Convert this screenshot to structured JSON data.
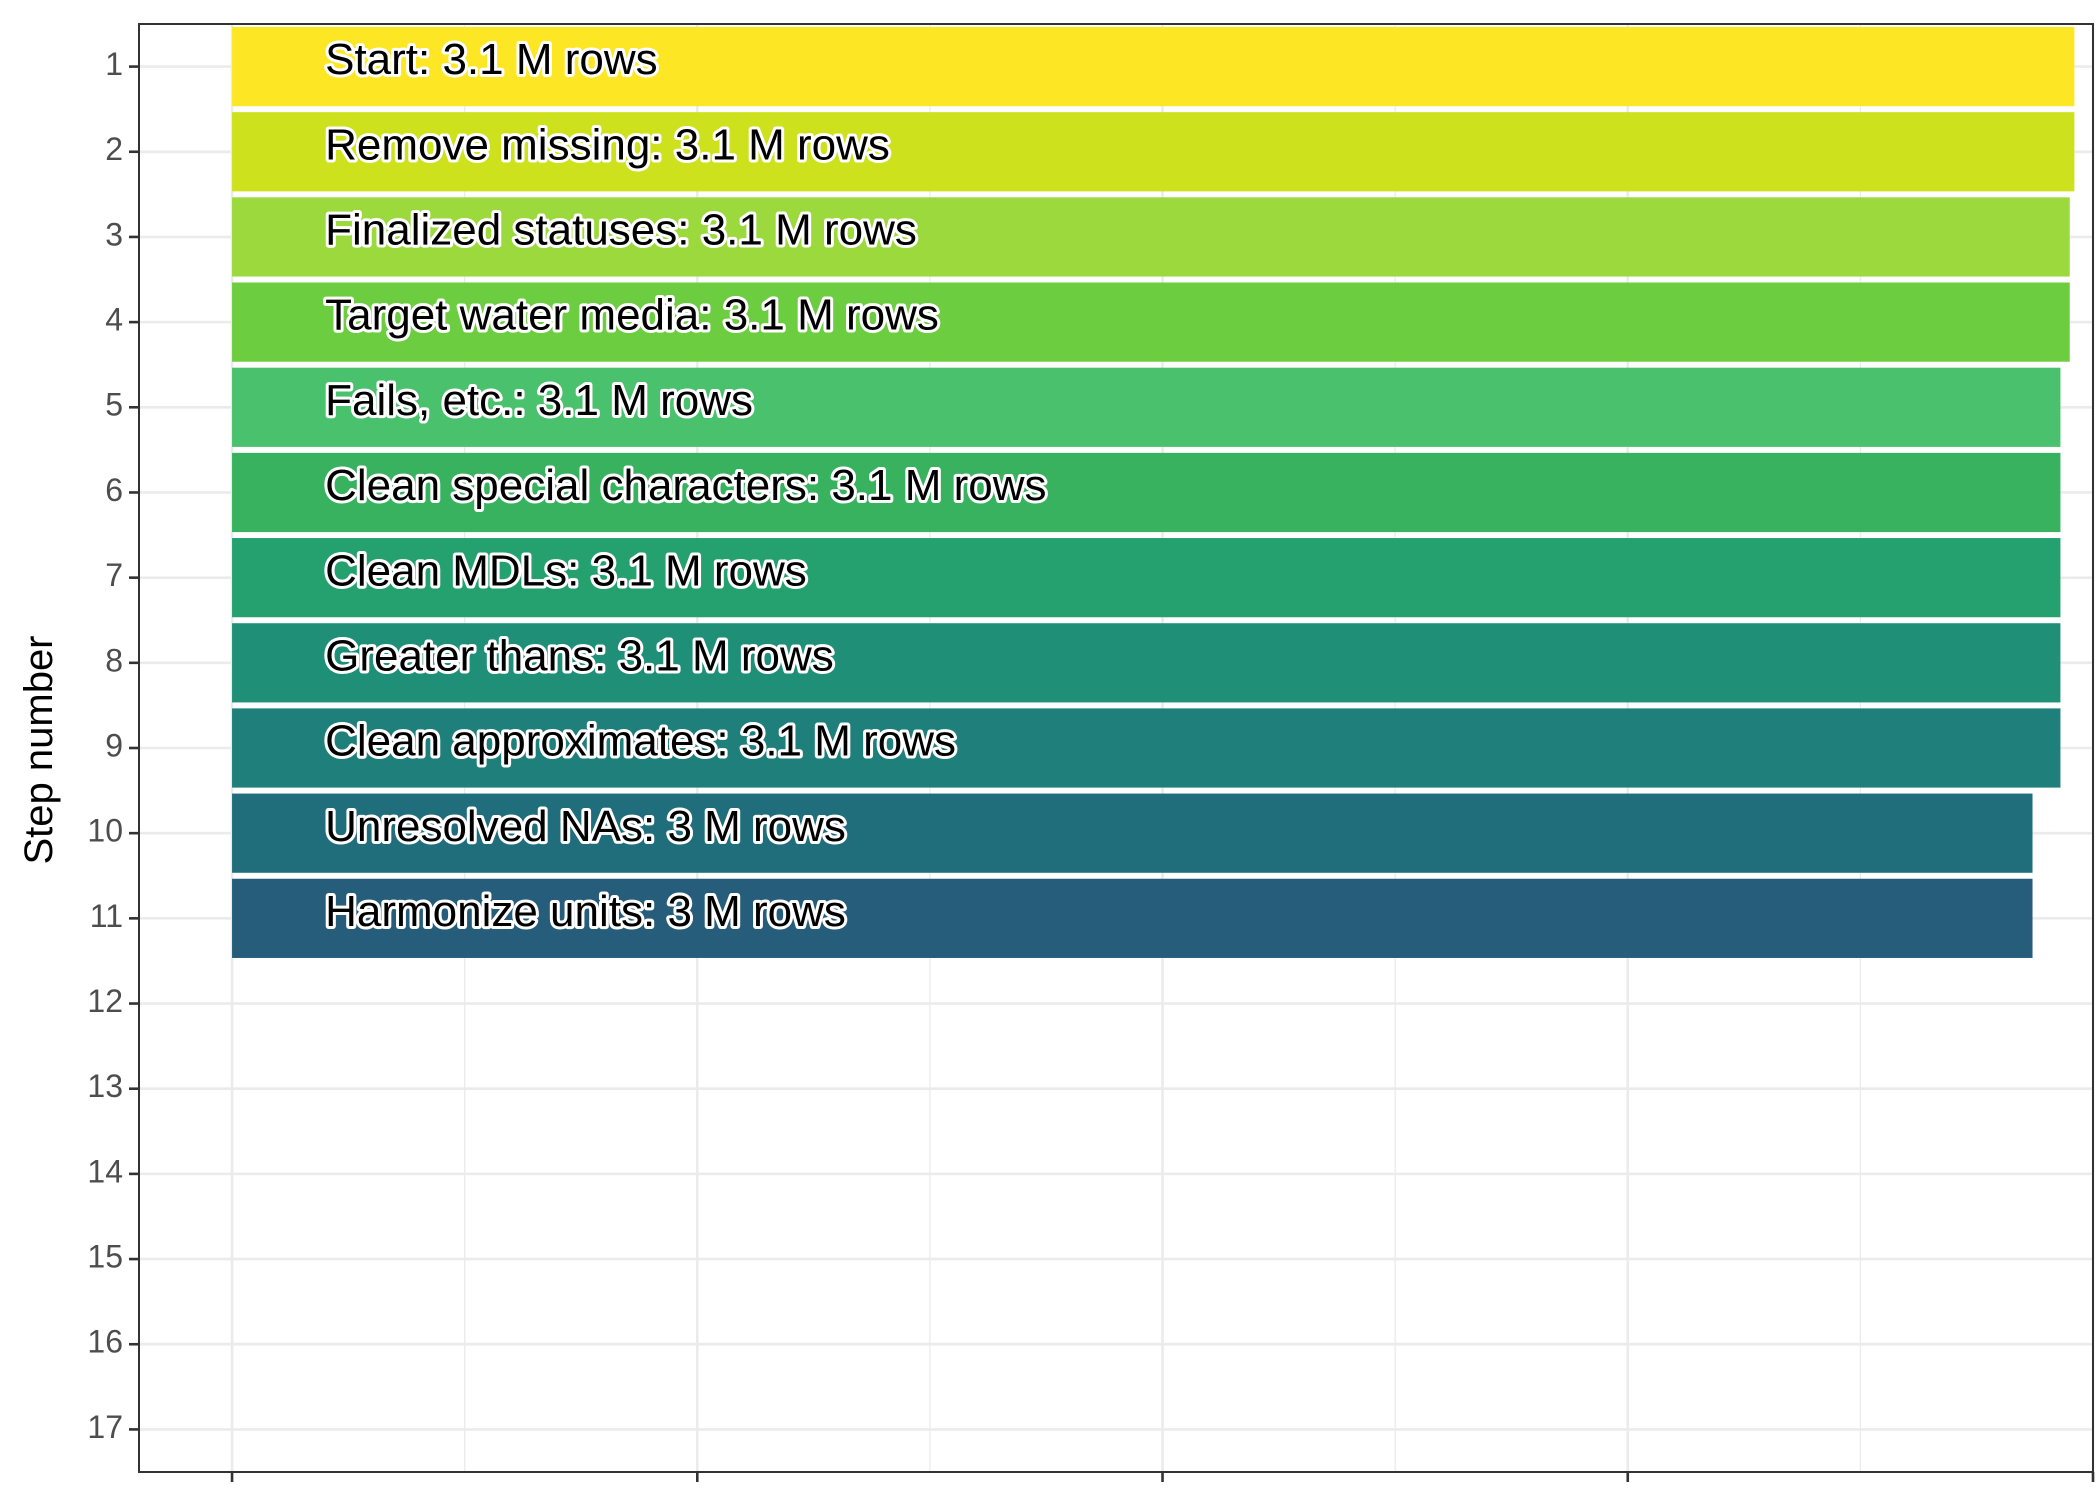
{
  "chart_data": {
    "type": "bar",
    "orientation": "horizontal",
    "title": "",
    "xlabel": "",
    "ylabel": "Step number",
    "y_ticks": [
      "1",
      "2",
      "3",
      "4",
      "5",
      "6",
      "7",
      "8",
      "9",
      "10",
      "11",
      "12",
      "13",
      "14",
      "15",
      "16",
      "17"
    ],
    "ylim": [
      0.5,
      17.5
    ],
    "xlim": [
      -0.2,
      4.0
    ],
    "grid": true,
    "legend": "none",
    "bars": [
      {
        "step": 1,
        "label": "Start:  3.1 M rows",
        "value": 3.96,
        "color": "#FDE725"
      },
      {
        "step": 2,
        "label": "Remove missing:  3.1 M rows",
        "value": 3.96,
        "color": "#CDE11D"
      },
      {
        "step": 3,
        "label": "Finalized statuses:  3.1 M rows",
        "value": 3.95,
        "color": "#9BD93C"
      },
      {
        "step": 4,
        "label": "Target water media:  3.1 M rows",
        "value": 3.95,
        "color": "#6DCD41"
      },
      {
        "step": 5,
        "label": "Fails, etc.:  3.1 M rows",
        "value": 3.93,
        "color": "#4AC16D"
      },
      {
        "step": 6,
        "label": "Clean special characters:  3.1 M rows",
        "value": 3.93,
        "color": "#38B25E"
      },
      {
        "step": 7,
        "label": "Clean MDLs:  3.1 M rows",
        "value": 3.93,
        "color": "#25A16F"
      },
      {
        "step": 8,
        "label": "Greater thans:  3.1 M rows",
        "value": 3.93,
        "color": "#1F9077"
      },
      {
        "step": 9,
        "label": "Clean approximates:  3.1 M rows",
        "value": 3.93,
        "color": "#1F7F7B"
      },
      {
        "step": 10,
        "label": "Unresolved NAs:  3 M rows",
        "value": 3.87,
        "color": "#206E7C"
      },
      {
        "step": 11,
        "label": "Harmonize units:  3 M rows",
        "value": 3.87,
        "color": "#255D7A"
      }
    ],
    "colors": {
      "panel_border": "#333333",
      "grid_major": "#EBEBEB",
      "tick": "#333333"
    }
  }
}
